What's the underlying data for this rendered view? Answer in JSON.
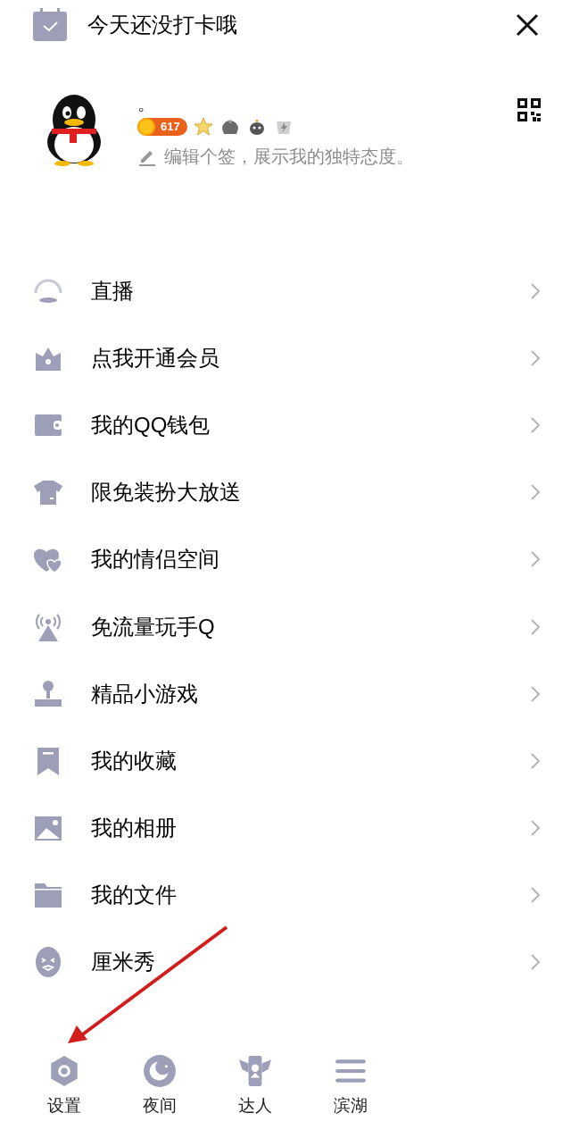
{
  "header": {
    "title": "今天还没打卡哦"
  },
  "profile": {
    "name": "。",
    "coins": "617",
    "signature": "编辑个签，展示我的独特态度。"
  },
  "menu": [
    {
      "label": "直播"
    },
    {
      "label": "点我开通会员"
    },
    {
      "label": "我的QQ钱包"
    },
    {
      "label": "限免装扮大放送"
    },
    {
      "label": "我的情侣空间"
    },
    {
      "label": "免流量玩手Q"
    },
    {
      "label": "精品小游戏"
    },
    {
      "label": "我的收藏"
    },
    {
      "label": "我的相册"
    },
    {
      "label": "我的文件"
    },
    {
      "label": "厘米秀"
    }
  ],
  "bottom_bar": [
    {
      "label": "设置"
    },
    {
      "label": "夜间"
    },
    {
      "label": "达人"
    },
    {
      "label": "滨湖"
    }
  ]
}
